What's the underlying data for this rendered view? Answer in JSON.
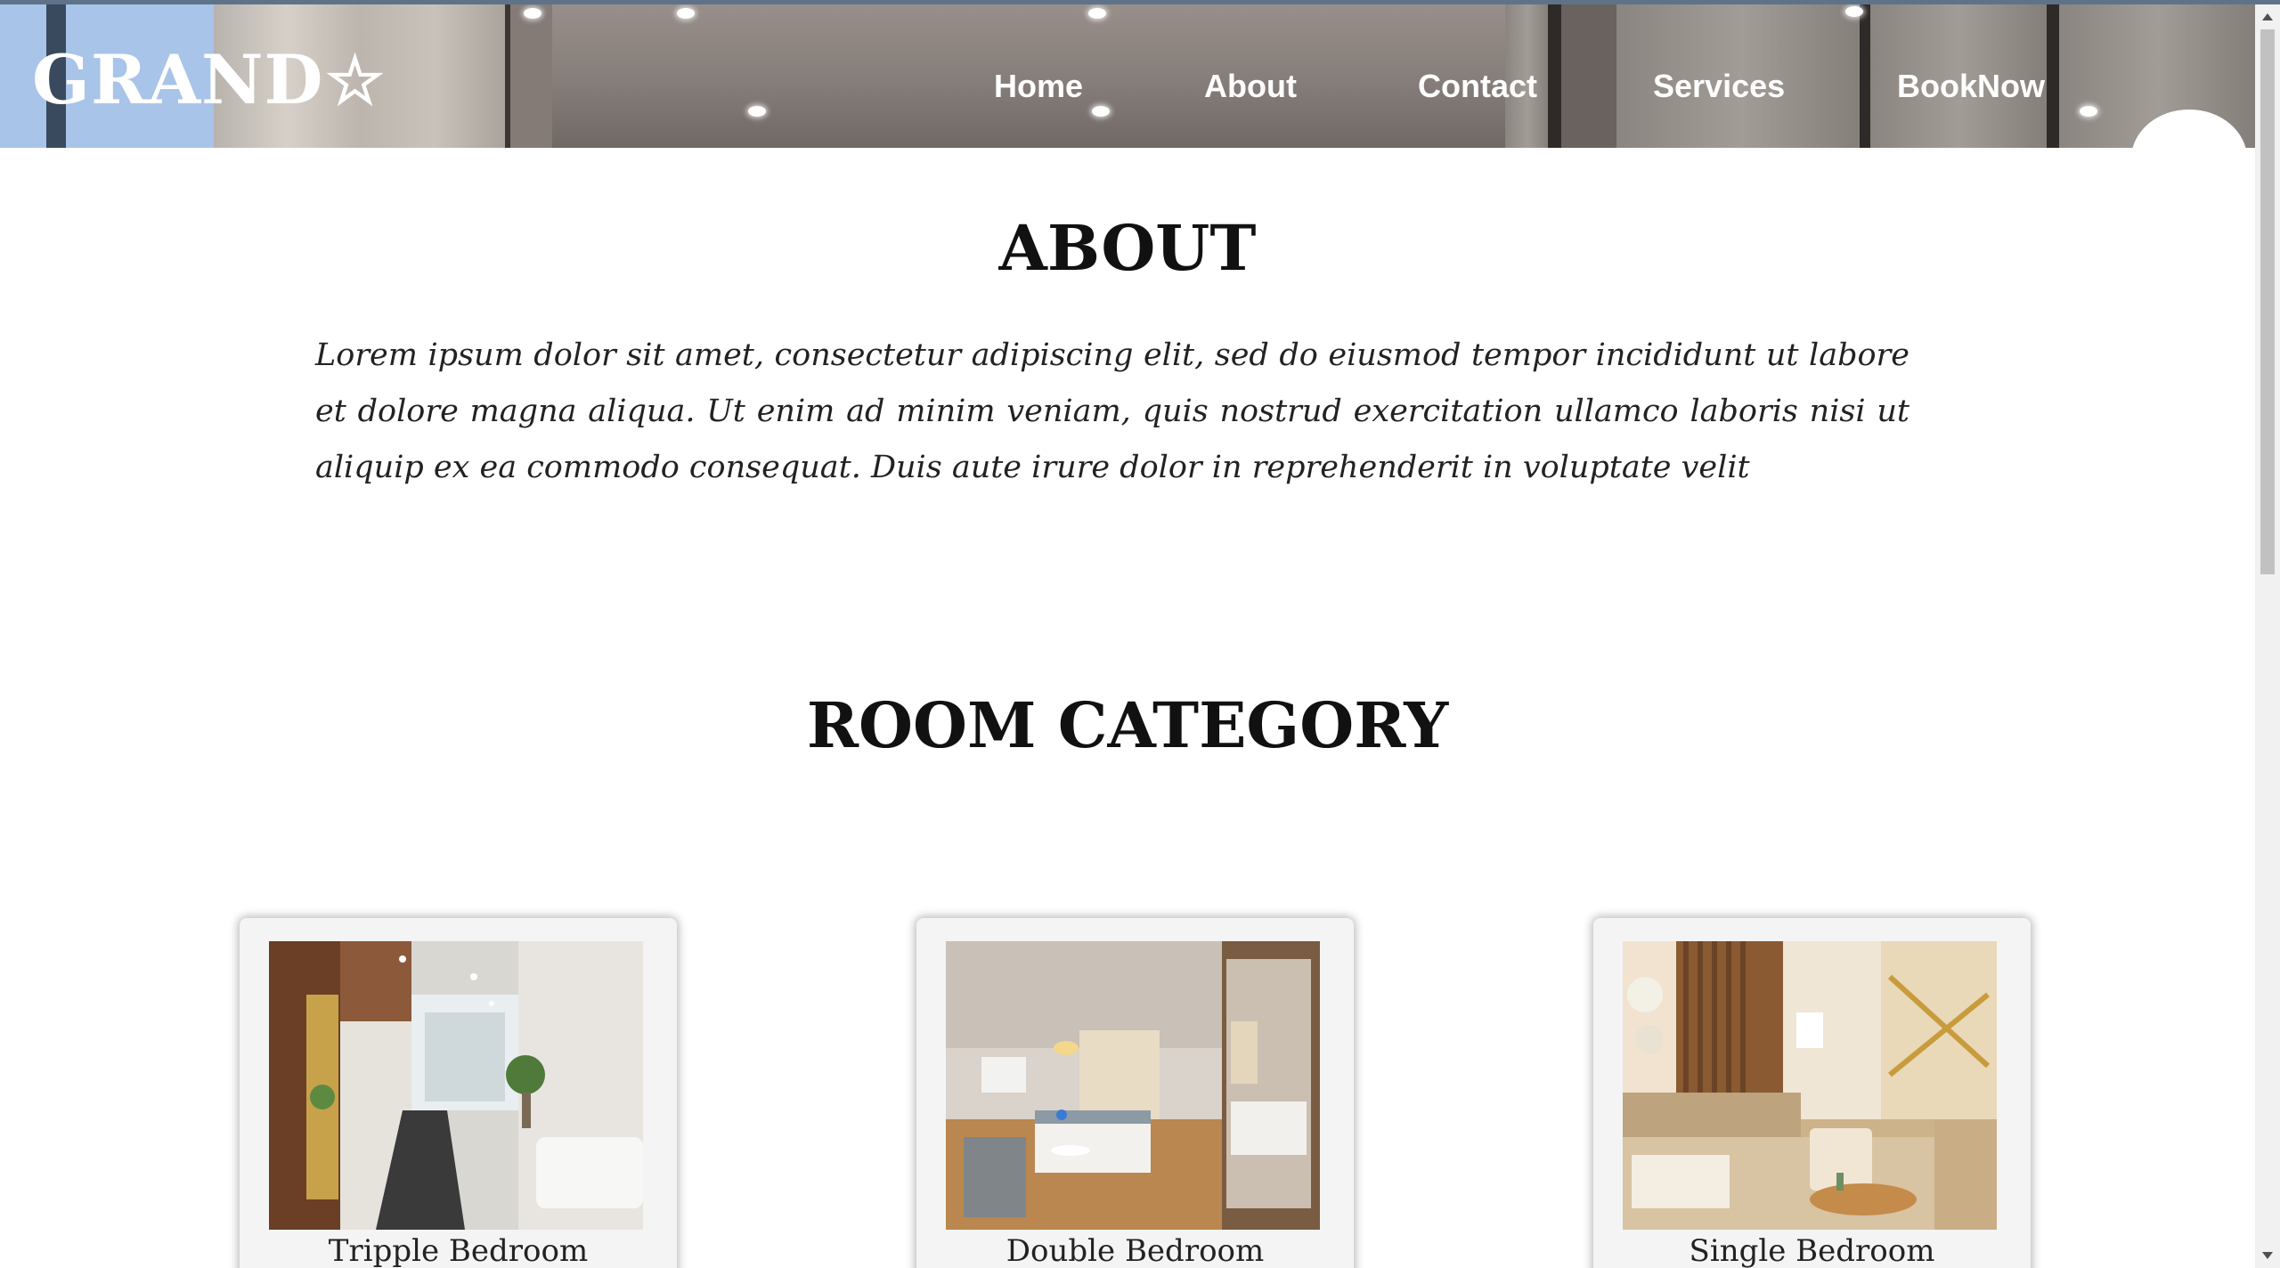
{
  "brand": {
    "logo_text": "GRAND",
    "logo_icon": "star-outline-icon"
  },
  "nav": {
    "items": [
      {
        "label": "Home"
      },
      {
        "label": "About"
      },
      {
        "label": "Contact"
      },
      {
        "label": "Services"
      },
      {
        "label": "BookNow"
      }
    ]
  },
  "about": {
    "title": "ABOUT",
    "text": "Lorem ipsum dolor sit amet, consectetur adipiscing elit, sed do eiusmod tempor incididunt ut labore et dolore magna aliqua. Ut enim ad minim veniam, quis nostrud exercitation ullamco laboris nisi ut aliquip ex ea commodo consequat. Duis aute irure dolor in reprehenderit in voluptate velit"
  },
  "rooms": {
    "title": "ROOM CATEGORY",
    "items": [
      {
        "label": "Tripple Bedroom"
      },
      {
        "label": "Double Bedroom"
      },
      {
        "label": "Single Bedroom"
      }
    ]
  },
  "colors": {
    "header_logo_bg": "#a8c4e8",
    "text": "#111111",
    "card_bg": "#f4f4f4",
    "scrollbar_thumb": "#c1c1c1"
  }
}
